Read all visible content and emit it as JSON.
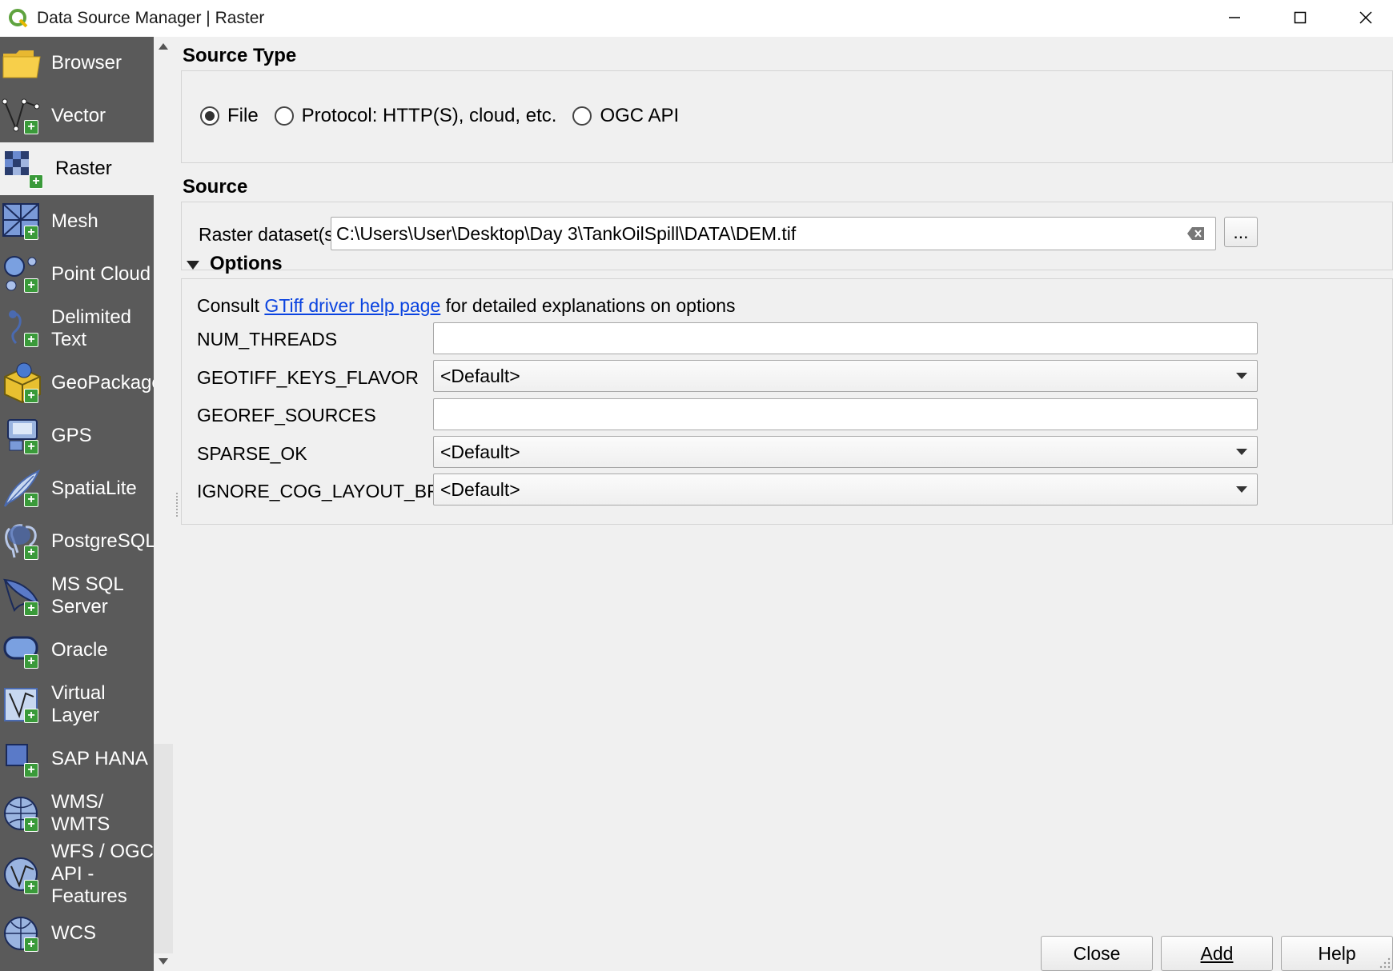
{
  "window": {
    "title": "Data Source Manager | Raster",
    "app_icon": "qgis-logo-icon"
  },
  "sidebar": {
    "items": [
      {
        "label": "Browser",
        "icon": "folder-icon"
      },
      {
        "label": "Vector",
        "icon": "vector-icon"
      },
      {
        "label": "Raster",
        "icon": "raster-icon",
        "active": true
      },
      {
        "label": "Mesh",
        "icon": "mesh-icon"
      },
      {
        "label": "Point Cloud",
        "icon": "point-cloud-icon"
      },
      {
        "label": "Delimited\nText",
        "icon": "delimited-text-icon"
      },
      {
        "label": "GeoPackage",
        "icon": "geopackage-icon"
      },
      {
        "label": "GPS",
        "icon": "gps-icon"
      },
      {
        "label": "SpatiaLite",
        "icon": "spatialite-icon"
      },
      {
        "label": "PostgreSQL",
        "icon": "postgresql-icon"
      },
      {
        "label": "MS SQL\nServer",
        "icon": "mssql-icon"
      },
      {
        "label": "Oracle",
        "icon": "oracle-icon"
      },
      {
        "label": "Virtual\nLayer",
        "icon": "virtual-layer-icon"
      },
      {
        "label": "SAP HANA",
        "icon": "sap-hana-icon"
      },
      {
        "label": "WMS/\nWMTS",
        "icon": "wms-icon"
      },
      {
        "label": "WFS / OGC\nAPI -\nFeatures",
        "icon": "wfs-icon"
      },
      {
        "label": "WCS",
        "icon": "wcs-icon"
      }
    ]
  },
  "source_type": {
    "heading": "Source Type",
    "options": [
      {
        "label": "File",
        "checked": true
      },
      {
        "label": "Protocol: HTTP(S), cloud, etc.",
        "checked": false
      },
      {
        "label": "OGC API",
        "checked": false
      }
    ]
  },
  "source": {
    "heading": "Source",
    "dataset_label": "Raster dataset(s)",
    "dataset_value": "C:\\Users\\User\\Desktop\\Day 3\\TankOilSpill\\DATA\\DEM.tif",
    "browse_label": "..."
  },
  "options": {
    "heading": "Options",
    "consult_prefix": "Consult ",
    "consult_link": "GTiff driver help page",
    "consult_suffix": " for detailed explanations on options",
    "fields": [
      {
        "label": "NUM_THREADS",
        "type": "text",
        "value": ""
      },
      {
        "label": "GEOTIFF_KEYS_FLAVOR",
        "type": "combo",
        "value": "<Default>"
      },
      {
        "label": "GEOREF_SOURCES",
        "type": "text",
        "value": ""
      },
      {
        "label": "SPARSE_OK",
        "type": "combo",
        "value": "<Default>"
      },
      {
        "label": "IGNORE_COG_LAYOUT_BREAK",
        "type": "combo",
        "value": "<Default>"
      }
    ]
  },
  "buttons": {
    "close": "Close",
    "add": "Add",
    "help": "Help"
  },
  "colors": {
    "sidebar_bg": "#5a5a5a",
    "link": "#0a43e0",
    "plus_badge": "#3a9a3a"
  }
}
